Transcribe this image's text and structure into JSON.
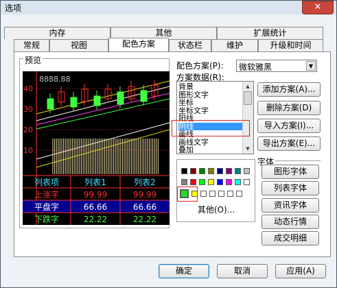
{
  "window": {
    "title": "选项",
    "close_glyph": "✕"
  },
  "tabs_row1": [
    {
      "label": "内存"
    },
    {
      "label": "其他"
    },
    {
      "label": "扩展统计"
    }
  ],
  "tabs_row2": [
    {
      "label": "常规"
    },
    {
      "label": "视图"
    },
    {
      "label": "配色方案",
      "active": true
    },
    {
      "label": "状态栏"
    },
    {
      "label": "维护"
    },
    {
      "label": "升级和时间"
    }
  ],
  "preview": {
    "label": "预览",
    "price_label": "8888.88",
    "y_ticks": [
      "40",
      "30",
      "20",
      "10"
    ],
    "table": {
      "headers": [
        "列表项",
        "列表1",
        "列表2"
      ],
      "rows": [
        [
          "上涨字",
          "99.99",
          "99.99"
        ],
        [
          "平盘字",
          "66.66",
          "66.66"
        ],
        [
          "下跌字",
          "22.22",
          "22.22"
        ]
      ]
    }
  },
  "scheme": {
    "label": "配色方案(P):",
    "selected": "微软雅黑",
    "arrow": "▼"
  },
  "scheme_data": {
    "label": "方案数据(R):",
    "items": [
      "背景",
      "图形文字",
      "坐标",
      "坐标文字",
      "阳线",
      "阴线",
      "画线",
      "画线文字",
      "叠加"
    ],
    "selected_index": 5
  },
  "palette": {
    "other_label": "其他(O)...",
    "colors": [
      "#000000",
      "#800000",
      "#008000",
      "#808000",
      "#000080",
      "#800080",
      "#008080",
      "#c0c0c0",
      "#808080",
      "#ff0000",
      "#00ff00",
      "#ffff00",
      "#0000ff",
      "#ff00ff",
      "#00ffff",
      "#ffffff"
    ],
    "current": "#22dd22"
  },
  "buttons": {
    "add_scheme": "添加方案(A)...",
    "delete_scheme": "删除方案(D)",
    "import_scheme": "导入方案(I)...",
    "export_scheme": "导出方案(E)...",
    "font_group": "字体",
    "chart_font": "图形字体",
    "list_font": "列表字体",
    "news_font": "资讯字体",
    "dynamic_font": "动态行情",
    "trade_detail": "成交明细",
    "ok": "确定",
    "cancel": "取消",
    "apply": "应用(A)"
  }
}
